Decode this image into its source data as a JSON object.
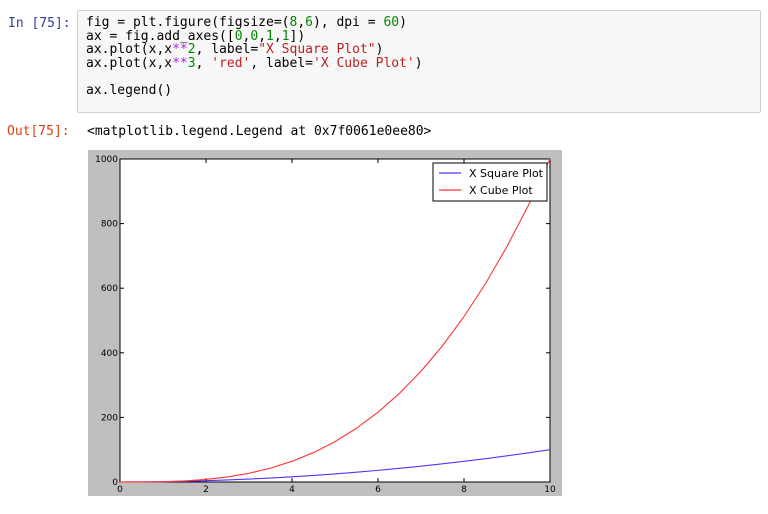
{
  "cell": {
    "in_prompt": "In [75]:",
    "out_prompt": "Out[75]:",
    "code_lines": [
      [
        {
          "t": "fig = plt.figure(figsize=(",
          "c": ""
        },
        {
          "t": "8",
          "c": "num"
        },
        {
          "t": ",",
          "c": ""
        },
        {
          "t": "6",
          "c": "num"
        },
        {
          "t": "), dpi = ",
          "c": ""
        },
        {
          "t": "60",
          "c": "num"
        },
        {
          "t": ")",
          "c": ""
        }
      ],
      [
        {
          "t": "ax = fig.add_axes([",
          "c": ""
        },
        {
          "t": "0",
          "c": "num"
        },
        {
          "t": ",",
          "c": ""
        },
        {
          "t": "0",
          "c": "num"
        },
        {
          "t": ",",
          "c": ""
        },
        {
          "t": "1",
          "c": "num"
        },
        {
          "t": ",",
          "c": ""
        },
        {
          "t": "1",
          "c": "num"
        },
        {
          "t": "])",
          "c": ""
        }
      ],
      [
        {
          "t": "ax.plot(x,x",
          "c": ""
        },
        {
          "t": "**",
          "c": "op"
        },
        {
          "t": "2",
          "c": "num"
        },
        {
          "t": ", label=",
          "c": ""
        },
        {
          "t": "\"X Square Plot\"",
          "c": "str"
        },
        {
          "t": ")",
          "c": ""
        }
      ],
      [
        {
          "t": "ax.plot(x,x",
          "c": ""
        },
        {
          "t": "**",
          "c": "op"
        },
        {
          "t": "3",
          "c": "num"
        },
        {
          "t": ", ",
          "c": ""
        },
        {
          "t": "'red'",
          "c": "str"
        },
        {
          "t": ", label=",
          "c": ""
        },
        {
          "t": "'X Cube Plot'",
          "c": "str"
        },
        {
          "t": ")",
          "c": ""
        }
      ],
      [],
      [
        {
          "t": "ax.legend()",
          "c": ""
        }
      ]
    ],
    "output_text": "<matplotlib.legend.Legend at 0x7f0061e0ee80>"
  },
  "colors": {
    "in_prompt": "#303f9f",
    "out_prompt": "#d84315",
    "figure_bg": "#bfbfbf",
    "axes_bg": "#ffffff"
  },
  "chart_data": {
    "type": "line",
    "title": "",
    "xlabel": "",
    "ylabel": "",
    "xlim": [
      0,
      10
    ],
    "ylim": [
      0,
      1000
    ],
    "xticks": [
      "0",
      "2",
      "4",
      "6",
      "8",
      "10"
    ],
    "yticks": [
      "0",
      "200",
      "400",
      "600",
      "800",
      "1000"
    ],
    "grid": false,
    "legend_position": "upper-right",
    "x": [
      0,
      0.5,
      1,
      1.5,
      2,
      2.5,
      3,
      3.5,
      4,
      4.5,
      5,
      5.5,
      6,
      6.5,
      7,
      7.5,
      8,
      8.5,
      9,
      9.5,
      10
    ],
    "series": [
      {
        "name": "X Square Plot",
        "color": "#5533ff",
        "values": [
          0,
          0.25,
          1,
          2.25,
          4,
          6.25,
          9,
          12.25,
          16,
          20.25,
          25,
          30.25,
          36,
          42.25,
          49,
          56.25,
          64,
          72.25,
          81,
          90.25,
          100
        ]
      },
      {
        "name": "X Cube Plot",
        "color": "#ff3333",
        "values": [
          0,
          0.125,
          1,
          3.375,
          8,
          15.625,
          27,
          42.875,
          64,
          91.125,
          125,
          166.375,
          216,
          274.625,
          343,
          421.875,
          512,
          614.125,
          729,
          857.375,
          1000
        ]
      }
    ]
  }
}
